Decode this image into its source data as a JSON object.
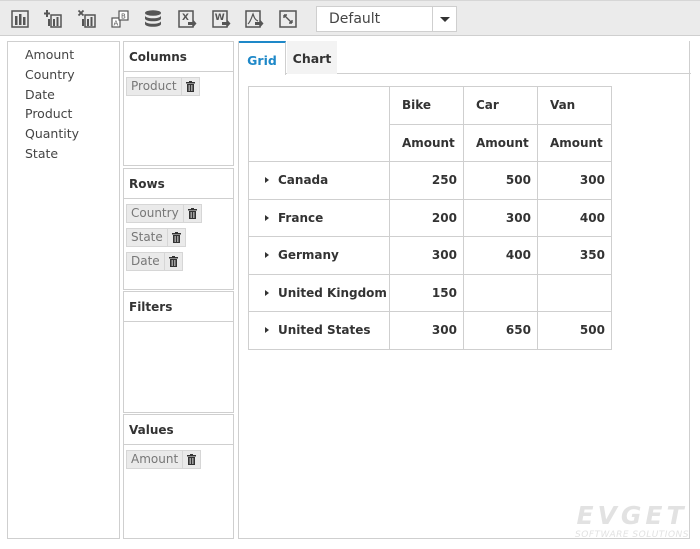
{
  "toolbar": {
    "buttons": [
      {
        "name": "pivot-chart-icon"
      },
      {
        "name": "add-column-icon"
      },
      {
        "name": "remove-column-icon"
      },
      {
        "name": "swap-axes-icon"
      },
      {
        "name": "database-icon"
      },
      {
        "name": "export-excel-icon"
      },
      {
        "name": "export-word-icon"
      },
      {
        "name": "export-pdf-icon"
      },
      {
        "name": "fullscreen-icon"
      }
    ],
    "report_select": {
      "value": "Default"
    }
  },
  "field_list": [
    "Amount",
    "Country",
    "Date",
    "Product",
    "Quantity",
    "State"
  ],
  "zones": {
    "columns": {
      "title": "Columns",
      "items": [
        "Product"
      ]
    },
    "rows": {
      "title": "Rows",
      "items": [
        "Country",
        "State",
        "Date"
      ]
    },
    "filters": {
      "title": "Filters",
      "items": []
    },
    "values": {
      "title": "Values",
      "items": [
        "Amount"
      ]
    }
  },
  "tabs": [
    {
      "label": "Grid",
      "active": true
    },
    {
      "label": "Chart",
      "active": false
    }
  ],
  "grid": {
    "column_headers": [
      "Bike",
      "Car",
      "Van"
    ],
    "measure_headers": [
      "Amount",
      "Amount",
      "Amount"
    ],
    "rows": [
      {
        "label": "Canada",
        "values": [
          "250",
          "500",
          "300"
        ]
      },
      {
        "label": "France",
        "values": [
          "200",
          "300",
          "400"
        ]
      },
      {
        "label": "Germany",
        "values": [
          "300",
          "400",
          "350"
        ]
      },
      {
        "label": "United Kingdom",
        "values": [
          "150",
          "",
          ""
        ]
      },
      {
        "label": "United States",
        "values": [
          "300",
          "650",
          "500"
        ]
      }
    ]
  },
  "watermark": {
    "title": "EVGET",
    "subtitle": "SOFTWARE SOLUTIONS"
  },
  "colors": {
    "accent": "#1e88c8",
    "border": "#cfcfcf",
    "toolbar_bg": "#ebebeb"
  }
}
